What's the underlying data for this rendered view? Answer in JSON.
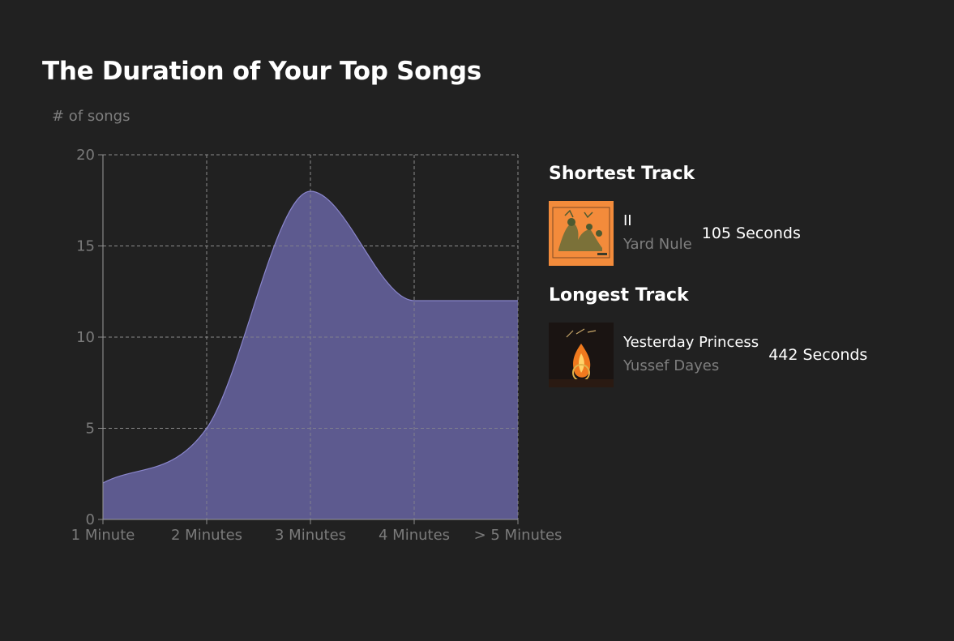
{
  "title": "The Duration of Your Top Songs",
  "chart_data": {
    "type": "area",
    "title": "The Duration of Your Top Songs",
    "ylabel": "# of songs",
    "xlabel": "",
    "categories": [
      "1 Minute",
      "2 Minutes",
      "3 Minutes",
      "4 Minutes",
      "> 5 Minutes"
    ],
    "values": [
      2,
      5,
      18,
      12,
      12
    ],
    "ylim": [
      0,
      20
    ],
    "yticks": [
      0,
      5,
      10,
      15,
      20
    ],
    "grid": true,
    "fill_color": "#5f5c92",
    "line_color": "#8a86cc"
  },
  "shortest": {
    "heading": "Shortest Track",
    "name": "II",
    "artist": "Yard Nule",
    "duration": "105 Seconds",
    "cover_color": "#f08a3a"
  },
  "longest": {
    "heading": "Longest Track",
    "name": "Yesterday Princess",
    "artist": "Yussef Dayes",
    "duration": "442 Seconds",
    "cover_color": "#1a1412"
  }
}
